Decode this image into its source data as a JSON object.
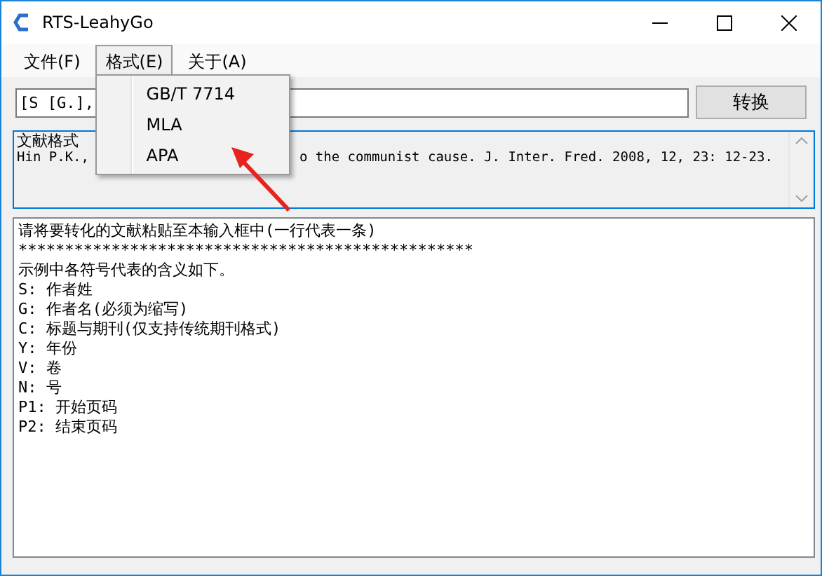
{
  "window": {
    "title": "RTS-LeahyGo"
  },
  "menu_bar": [
    {
      "label": "文件(F)",
      "selected": false
    },
    {
      "label": "格式(E)",
      "selected": true
    },
    {
      "label": "关于(A)",
      "selected": false
    }
  ],
  "dropdown": {
    "items": [
      "GB/T 7714",
      "MLA",
      "APA"
    ]
  },
  "input": {
    "value": "[S [G.],"
  },
  "convert_button": "转换",
  "format_box": {
    "label": "文献格式",
    "example_parts": [
      "Hin P.K.,",
      "o the communist cause. J. Inter. Fred. 2008, 12, 23: 12-23."
    ]
  },
  "text_area": {
    "lines": [
      "请将要转化的文献粘贴至本输入框中(一行代表一条)",
      "*************************************************",
      "示例中各符号代表的含义如下。",
      "S: 作者姓",
      "G: 作者名(必须为缩写)",
      "C: 标题与期刊(仅支持传统期刊格式)",
      "Y: 年份",
      "V: 卷",
      "N: 号",
      "P1: 开始页码",
      "P2: 结束页码"
    ]
  }
}
